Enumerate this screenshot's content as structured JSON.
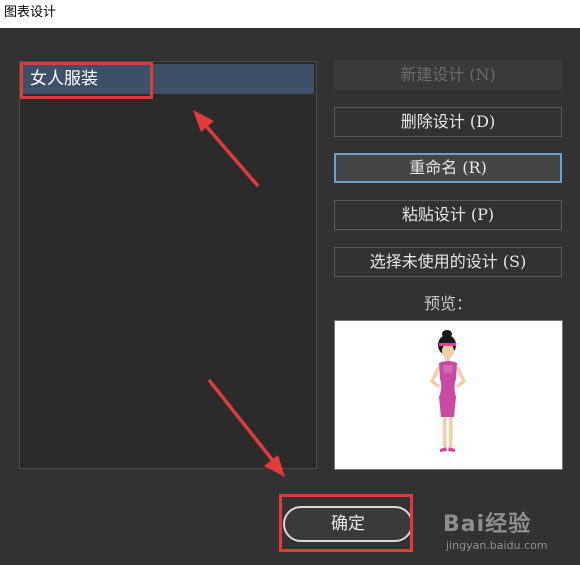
{
  "window": {
    "title": "图表设计"
  },
  "designs": {
    "items": [
      {
        "label": "女人服装"
      }
    ]
  },
  "buttons": {
    "new": "新建设计 (N)",
    "delete": "删除设计 (D)",
    "rename": "重命名 (R)",
    "paste": "粘贴设计 (P)",
    "select_unused": "选择未使用的设计 (S)",
    "ok": "确定"
  },
  "preview": {
    "label": "预览："
  },
  "watermark": {
    "brand": "Bai经验",
    "url": "jingyan.baidu.com"
  },
  "colors": {
    "annotation": "#e03b3b",
    "selection": "#3e5068",
    "focus": "#6a9fd4"
  }
}
